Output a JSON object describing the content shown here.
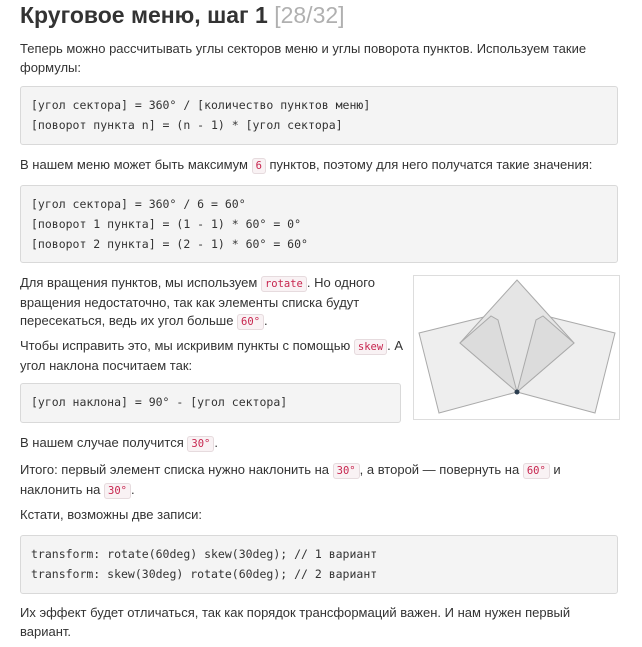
{
  "title": {
    "text": "Круговое меню, шаг 1",
    "step": "[28/32]"
  },
  "intro": {
    "text": "Теперь можно рассчитывать углы секторов меню и углы поворота пунктов. Используем такие формулы:"
  },
  "formulas_code": [
    "[угол сектора] = 360° / [количество пунктов меню]",
    "[поворот пункта n] = (n - 1) * [угол сектора]"
  ],
  "max_items": {
    "before": "В нашем меню может быть максимум ",
    "value": "6",
    "after": " пунктов, поэтому для него получатся такие значения:"
  },
  "values_code": [
    "[угол сектора] = 360° / 6 = 60°",
    "[поворот 1 пункта] = (1 - 1) * 60° = 0°",
    "[поворот 2 пункта] = (2 - 1) * 60° = 60°"
  ],
  "rotate_para": {
    "before": "Для вращения пунктов, мы используем ",
    "code": "rotate",
    "middle": ". Но одного вращения недостаточно, так как элементы списка будут пересекаться, ведь их угол больше ",
    "angle": "60°",
    "after": "."
  },
  "skew_para": {
    "before": "Чтобы исправить это, мы искривим пункты с помощью ",
    "code": "skew",
    "after": ". А угол наклона посчитаем так:"
  },
  "skew_code": [
    "[угол наклона] = 90° - [угол сектора]"
  ],
  "result_para": {
    "before": "В нашем случае получится ",
    "value": "30°",
    "after": "."
  },
  "summary_para": {
    "p1": "Итого: первый элемент списка нужно наклонить на ",
    "v1": "30°",
    "p2": ", а второй — повернуть на ",
    "v2": "60°",
    "p3": " и наклонить на ",
    "v3": "30°",
    "p4": "."
  },
  "notations_para": {
    "text": "Кстати, возможны две записи:"
  },
  "transform_code": [
    "transform: rotate(60deg) skew(30deg); // 1 вариант",
    "transform: skew(30deg) rotate(60deg); // 2 вариант"
  ],
  "final_para": {
    "text": "Их эффект будет отличаться, так как порядок трансформаций важен. И нам нужен первый вариант."
  },
  "colors": {
    "text": "#333333",
    "step": "#b0b0b0",
    "code_bg": "#f4f4f4",
    "inline_code": "#c7254e",
    "shape_fill": "#eeeeee",
    "shape_stroke": "#aaaaaa",
    "pivot": "#2c3e50"
  }
}
